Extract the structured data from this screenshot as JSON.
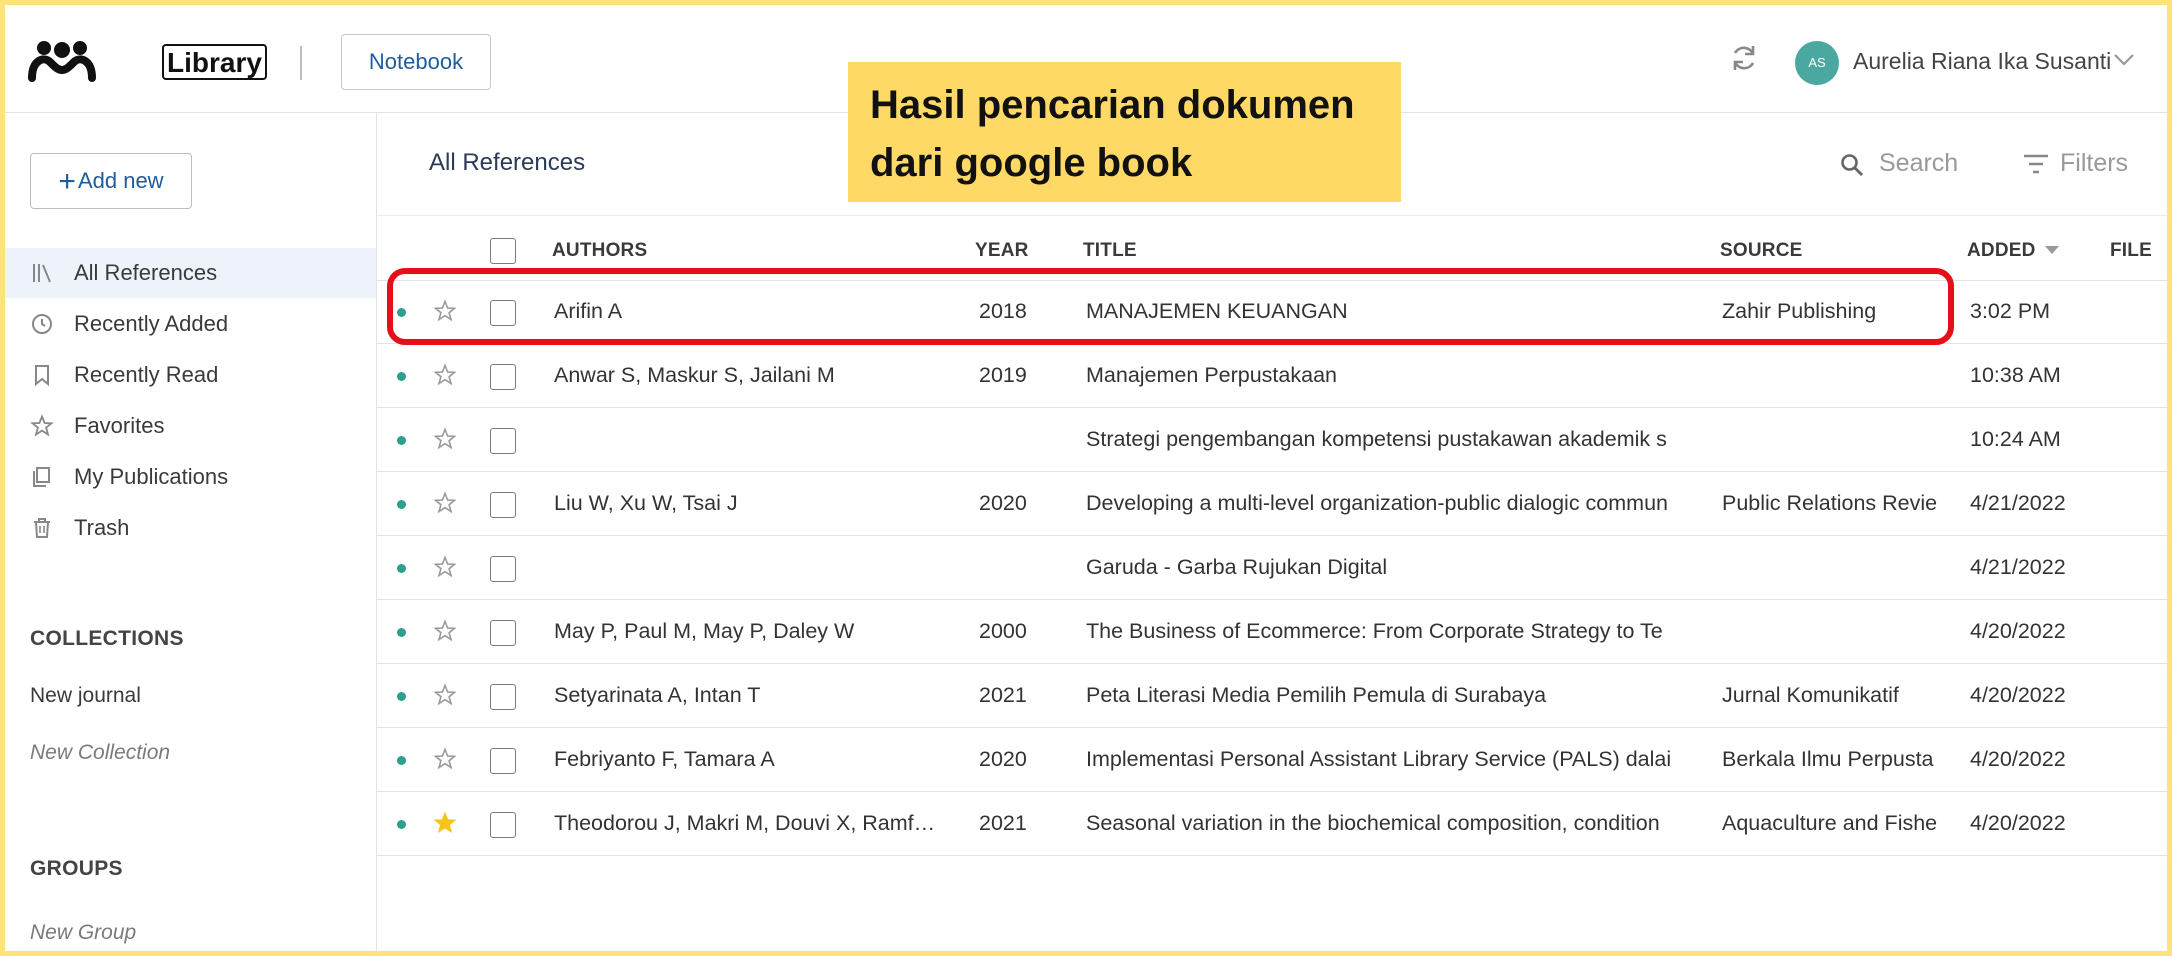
{
  "topbar": {
    "library_label": "Library",
    "notebook_label": "Notebook",
    "user": {
      "initials": "AS",
      "name": "Aurelia Riana Ika Susanti"
    }
  },
  "sidebar": {
    "add_new_label": "Add new",
    "nav": [
      {
        "label": "All References",
        "icon": "library-icon",
        "active": true
      },
      {
        "label": "Recently Added",
        "icon": "clock-icon"
      },
      {
        "label": "Recently Read",
        "icon": "bookmark-icon"
      },
      {
        "label": "Favorites",
        "icon": "star-icon"
      },
      {
        "label": "My Publications",
        "icon": "publications-icon"
      },
      {
        "label": "Trash",
        "icon": "trash-icon"
      }
    ],
    "collections_heading": "COLLECTIONS",
    "collections": [
      "New journal"
    ],
    "new_collection_label": "New Collection",
    "groups_heading": "GROUPS",
    "new_group_label": "New Group"
  },
  "main": {
    "title": "All References",
    "search_placeholder": "Search",
    "filters_label": "Filters",
    "columns": {
      "authors": "AUTHORS",
      "year": "YEAR",
      "title": "TITLE",
      "source": "SOURCE",
      "added": "ADDED",
      "file": "FILE"
    },
    "rows": [
      {
        "authors": "Arifin A",
        "year": "2018",
        "title": "MANAJEMEN KEUANGAN",
        "source": "Zahir Publishing",
        "added": "3:02 PM",
        "starred": false
      },
      {
        "authors": "Anwar S, Maskur S, Jailani M",
        "year": "2019",
        "title": "Manajemen Perpustakaan",
        "source": "",
        "added": "10:38 AM",
        "starred": false
      },
      {
        "authors": "",
        "year": "",
        "title": "Strategi pengembangan kompetensi pustakawan akademik s",
        "source": "",
        "added": "10:24 AM",
        "starred": false
      },
      {
        "authors": "Liu W, Xu W, Tsai J",
        "year": "2020",
        "title": "Developing a multi-level organization-public dialogic commun",
        "source": "Public Relations Revie",
        "added": "4/21/2022",
        "starred": false
      },
      {
        "authors": "",
        "year": "",
        "title": "Garuda - Garba Rujukan Digital",
        "source": "",
        "added": "4/21/2022",
        "starred": false
      },
      {
        "authors": "May P, Paul M, May P, Daley W",
        "year": "2000",
        "title": "The Business of Ecommerce: From Corporate Strategy to Te",
        "source": "",
        "added": "4/20/2022",
        "starred": false
      },
      {
        "authors": "Setyarinata A, Intan T",
        "year": "2021",
        "title": "Peta Literasi Media Pemilih Pemula di Surabaya",
        "source": "Jurnal Komunikatif",
        "added": "4/20/2022",
        "starred": false
      },
      {
        "authors": "Febriyanto F, Tamara A",
        "year": "2020",
        "title": "Implementasi Personal Assistant Library Service (PALS) dalai",
        "source": "Berkala Ilmu Perpusta",
        "added": "4/20/2022",
        "starred": false
      },
      {
        "authors": "Theodorou J, Makri M, Douvi X, Ramf…",
        "year": "2021",
        "title": " Seasonal variation in the biochemical composition, condition",
        "source": "Aquaculture and Fishe",
        "added": "4/20/2022",
        "starred": true
      }
    ]
  },
  "callout": {
    "line1": "Hasil pencarian dokumen",
    "line2": "dari google book",
    "color": "#ffd966"
  },
  "highlight_color": "#e3101a",
  "colors": {
    "accent": "#1f5d9a",
    "read_dot": "#2e9e8f",
    "star_filled": "#f5c518",
    "avatar": "#4aa8a0"
  }
}
